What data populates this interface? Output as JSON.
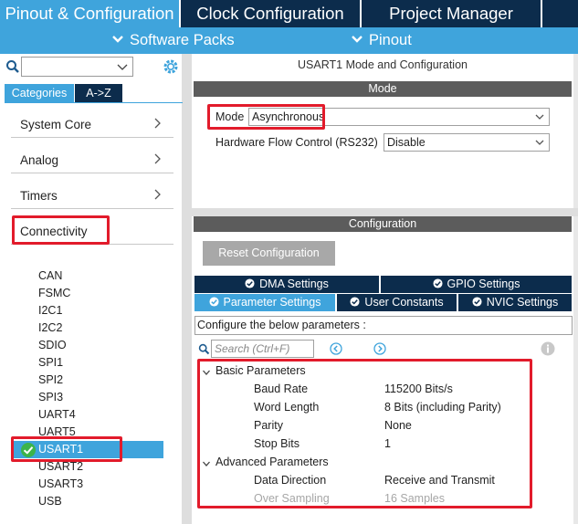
{
  "top_tabs": {
    "pinout": "Pinout & Configuration",
    "clock": "Clock Configuration",
    "project": "Project Manager"
  },
  "sub_bar": {
    "software_packs": "Software Packs",
    "pinout": "Pinout"
  },
  "sidebar": {
    "tabs": {
      "categories": "Categories",
      "az": "A->Z"
    },
    "categories": [
      "System Core",
      "Analog",
      "Timers",
      "Connectivity"
    ],
    "peripherals": [
      "CAN",
      "FSMC",
      "I2C1",
      "I2C2",
      "SDIO",
      "SPI1",
      "SPI2",
      "SPI3",
      "UART4",
      "UART5",
      "USART1",
      "USART2",
      "USART3",
      "USB"
    ],
    "selected": "USART1"
  },
  "mode_panel": {
    "title": "USART1 Mode and Configuration",
    "section": "Mode",
    "mode_label": "Mode",
    "mode_value": "Asynchronous",
    "hw_flow_label": "Hardware Flow Control (RS232)",
    "hw_flow_value": "Disable"
  },
  "config_panel": {
    "section": "Configuration",
    "reset_label": "Reset Configuration",
    "tabs": {
      "dma": "DMA Settings",
      "gpio": "GPIO Settings",
      "params": "Parameter Settings",
      "user_constants": "User Constants",
      "nvic": "NVIC Settings"
    },
    "hint": "Configure the below parameters :",
    "search_placeholder": "Search (Ctrl+F)",
    "basic_section": "Basic Parameters",
    "basic_params": [
      {
        "name": "Baud Rate",
        "value": "115200 Bits/s"
      },
      {
        "name": "Word Length",
        "value": "8 Bits (including Parity)"
      },
      {
        "name": "Parity",
        "value": "None"
      },
      {
        "name": "Stop Bits",
        "value": "1"
      }
    ],
    "advanced_section": "Advanced Parameters",
    "advanced_params": [
      {
        "name": "Data Direction",
        "value": "Receive and Transmit"
      },
      {
        "name": "Over Sampling",
        "value": "16 Samples"
      }
    ]
  },
  "colors": {
    "accent": "#3fa4dc",
    "navy": "#0c2c4c",
    "highlight_red": "#e21b2b"
  }
}
